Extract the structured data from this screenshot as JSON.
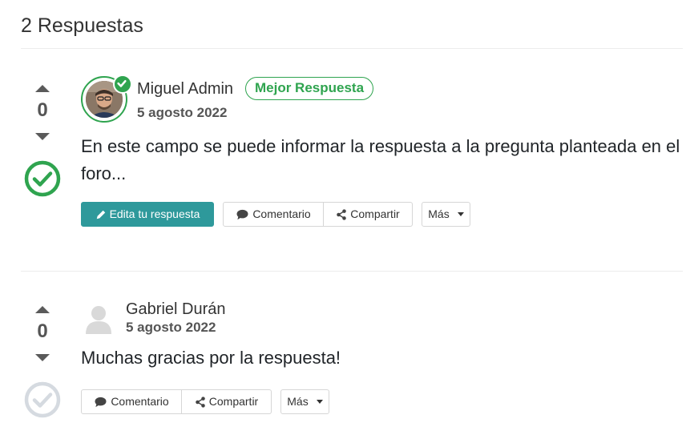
{
  "section_title": "2 Respuestas",
  "answers": [
    {
      "votes": "0",
      "accepted": true,
      "author": "Miguel Admin",
      "date": "5 agosto 2022",
      "best_badge": "Mejor Respuesta",
      "text": "En este campo se puede informar la respuesta a la pregunta planteada en el foro...",
      "actions": {
        "edit": "Edita tu respuesta",
        "comment": "Comentario",
        "share": "Compartir",
        "more": "Más"
      }
    },
    {
      "votes": "0",
      "accepted": false,
      "author": "Gabriel Durán",
      "date": "5 agosto 2022",
      "text": "Muchas gracias por la respuesta!",
      "actions": {
        "comment": "Comentario",
        "share": "Compartir",
        "more": "Más"
      }
    }
  ],
  "colors": {
    "accent_green": "#2fa44f",
    "primary_teal": "#2e999b",
    "unaccepted_gray": "#d5dae0"
  },
  "icons": {
    "upvote": "caret-up-icon",
    "downvote": "caret-down-icon",
    "accepted": "check-circle-icon",
    "edit": "pencil-icon",
    "comment": "comment-icon",
    "share": "share-icon",
    "more": "caret-down-icon",
    "verified": "check-badge-icon"
  }
}
